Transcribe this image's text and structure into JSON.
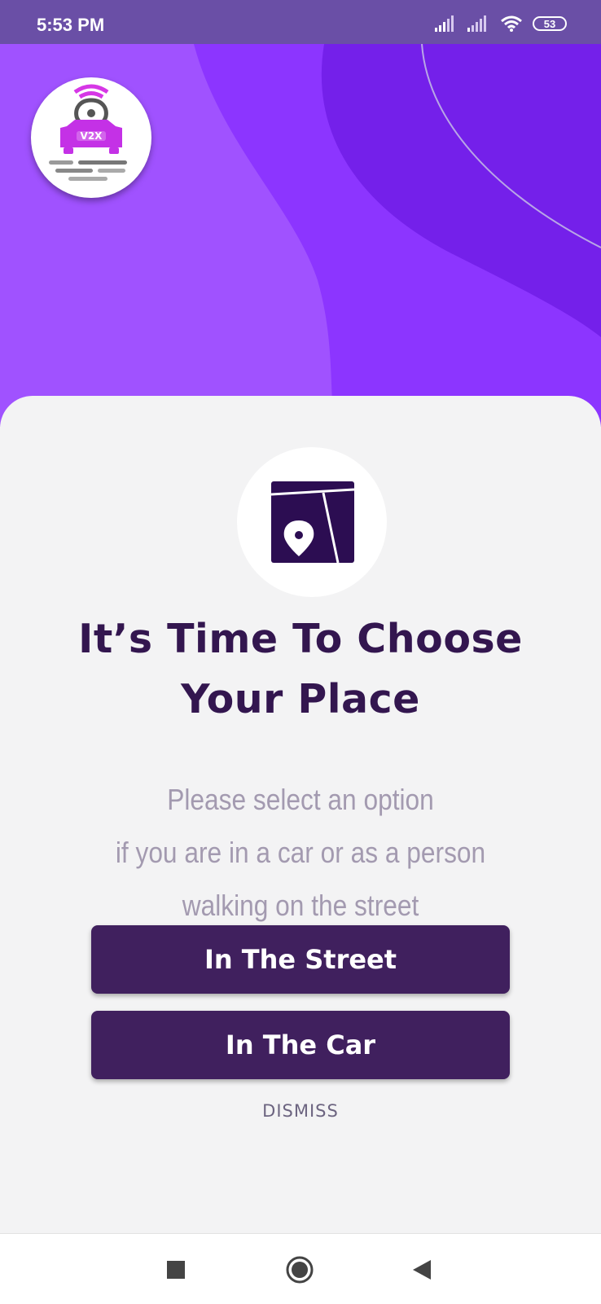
{
  "status_bar": {
    "time": "5:53 PM",
    "battery_level": "53",
    "icons": [
      "signal-icon",
      "signal-icon",
      "wifi-icon",
      "battery-icon"
    ]
  },
  "logo": {
    "text": "V2X",
    "icon": "car-location-logo"
  },
  "dialog": {
    "icon": "map-pin-icon",
    "title_line1": "It’s Time To Choose",
    "title_line2": "Your Place",
    "desc_line1": "Please select an option",
    "desc_line2": "if you are in a car or as a person",
    "desc_line3": "walking on the street",
    "street_button": "In The Street",
    "car_button": "In The Car",
    "dismiss_button": "DISMISS"
  },
  "colors": {
    "status_bar": "#6a4fa6",
    "hero_light": "#a052ff",
    "hero_mid": "#8c35ff",
    "hero_dark": "#7420ea",
    "primary": "#40205e",
    "card_bg": "#f3f3f4"
  },
  "nav_bar": {
    "icons": [
      "recents-icon",
      "home-icon",
      "back-icon"
    ]
  }
}
